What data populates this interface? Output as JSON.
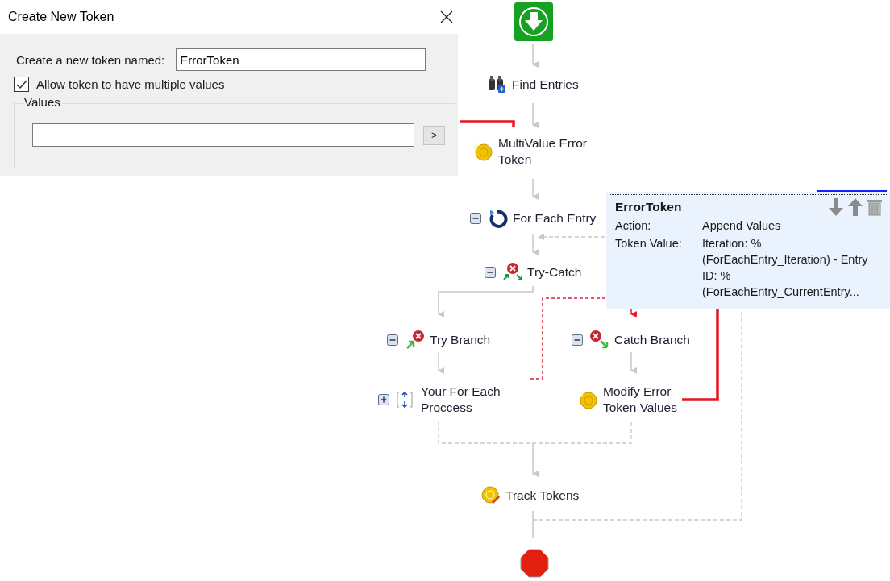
{
  "dialog": {
    "title": "Create New Token",
    "name_label": "Create a new token named:",
    "name_value": "ErrorToken",
    "allow_multiple": {
      "label": "Allow token to have multiple values",
      "checked": true
    },
    "values_group": {
      "label": "Values",
      "add_button": ">"
    }
  },
  "workflow": {
    "nodes": [
      {
        "kind": "start"
      },
      {
        "kind": "activity",
        "label": "Find Entries"
      },
      {
        "kind": "activity",
        "label": "MultiValue Error Token"
      },
      {
        "kind": "activity",
        "label": "For Each Entry",
        "expanded": true
      },
      {
        "kind": "activity",
        "label": "Try-Catch",
        "expanded": true
      },
      {
        "kind": "activity",
        "label": "Try Branch",
        "expanded": true
      },
      {
        "kind": "activity",
        "label": "Catch Branch",
        "expanded": true
      },
      {
        "kind": "activity",
        "label": "Your For Each Proccess",
        "expanded": false
      },
      {
        "kind": "activity",
        "label": "Modify Error Token Values"
      },
      {
        "kind": "activity",
        "label": "Track Tokens"
      },
      {
        "kind": "end"
      }
    ]
  },
  "token_card": {
    "title": "ErrorToken",
    "rows": [
      {
        "label": "Action:",
        "value": "Append Values"
      },
      {
        "label": "Token Value:",
        "value": "Iteration: %(ForEachEntry_Iteration) - Entry ID: %(ForEachEntry_CurrentEntry..."
      }
    ]
  }
}
